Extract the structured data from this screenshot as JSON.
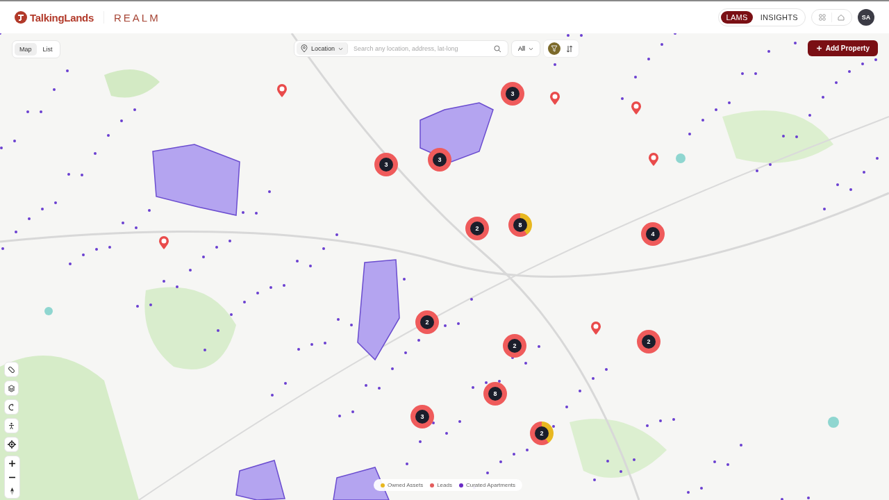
{
  "header": {
    "brand": "TalkingLands",
    "product": "REALM",
    "modes": [
      {
        "label": "LAMS",
        "selected": true
      },
      {
        "label": "INSIGHTS",
        "selected": false
      }
    ],
    "avatar": "SA"
  },
  "view_toggle": [
    {
      "label": "Map",
      "selected": true
    },
    {
      "label": "List",
      "selected": false
    }
  ],
  "search": {
    "scope": "Location",
    "placeholder": "Search any location, address, lat-long",
    "filter": "All"
  },
  "add_button": "Add Property",
  "map": {
    "clusters": [
      {
        "count": "3",
        "owned": false
      },
      {
        "count": "3",
        "owned": false
      },
      {
        "count": "3",
        "owned": false
      },
      {
        "count": "2",
        "owned": false
      },
      {
        "count": "8",
        "owned": true
      },
      {
        "count": "4",
        "owned": false
      },
      {
        "count": "2",
        "owned": false
      },
      {
        "count": "2",
        "owned": false
      },
      {
        "count": "2",
        "owned": false
      },
      {
        "count": "8",
        "owned": false
      },
      {
        "count": "3",
        "owned": false
      },
      {
        "count": "2",
        "owned": true
      }
    ]
  },
  "legend": [
    {
      "label": "Owned Assets",
      "color": "#e8b820"
    },
    {
      "label": "Leads",
      "color": "#e35d5d"
    },
    {
      "label": "Curated Apartments",
      "color": "#6a2bc4"
    }
  ]
}
